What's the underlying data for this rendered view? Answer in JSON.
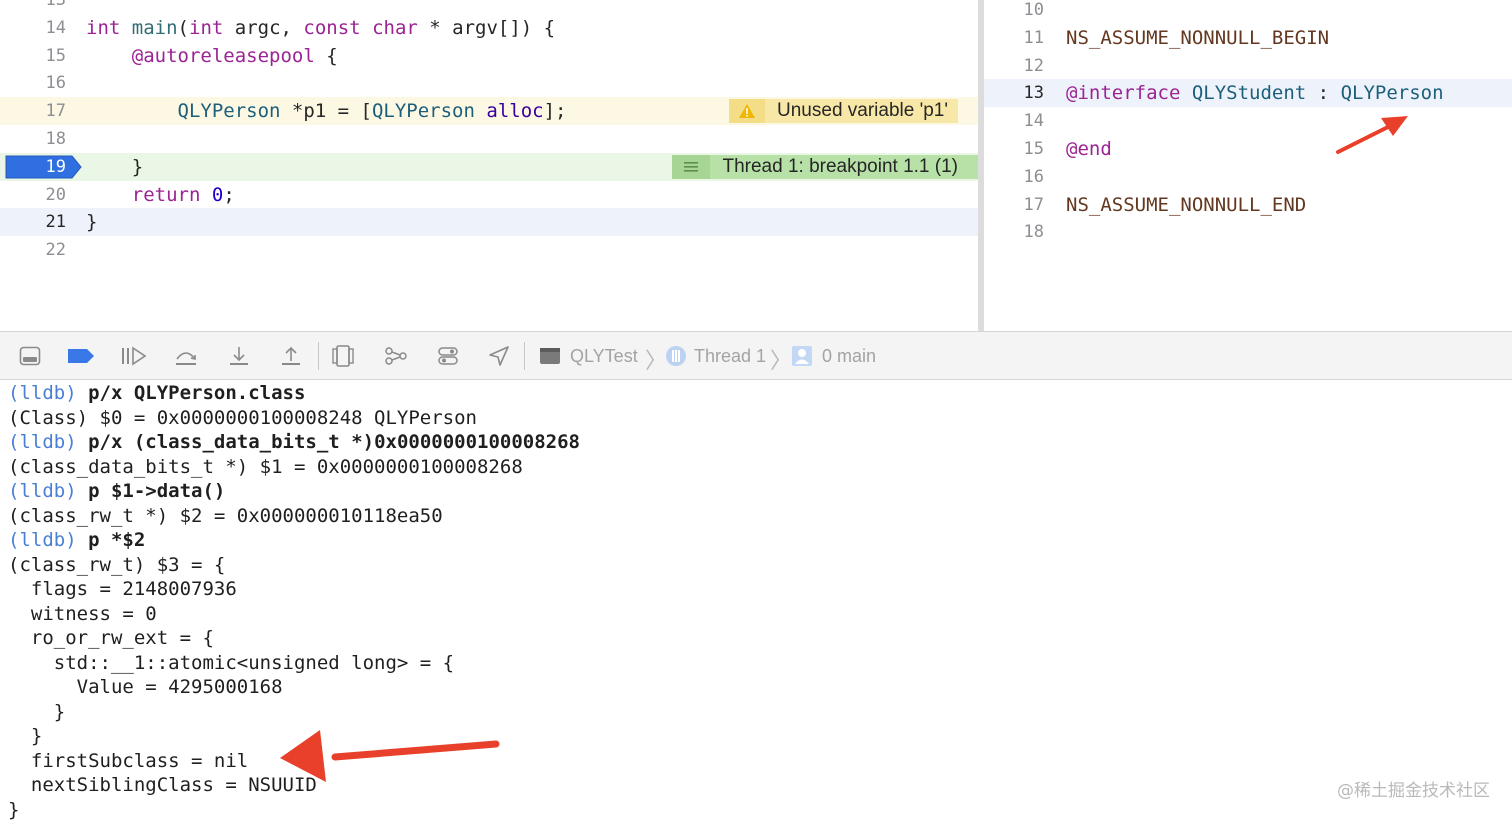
{
  "left_editor": {
    "lines": [
      {
        "num": "13"
      },
      {
        "num": "14",
        "parts": [
          {
            "t": "int",
            "c": "kw"
          },
          {
            "t": " ",
            "c": "pl"
          },
          {
            "t": "main",
            "c": "fn"
          },
          {
            "t": "(",
            "c": "pl"
          },
          {
            "t": "int",
            "c": "kw"
          },
          {
            "t": " argc, ",
            "c": "pl"
          },
          {
            "t": "const",
            "c": "kw"
          },
          {
            "t": " ",
            "c": "pl"
          },
          {
            "t": "char",
            "c": "kw"
          },
          {
            "t": " * argv[]) {",
            "c": "pl"
          }
        ]
      },
      {
        "num": "15",
        "parts": [
          {
            "t": "    ",
            "c": "pl"
          },
          {
            "t": "@autoreleasepool",
            "c": "kw"
          },
          {
            "t": " {",
            "c": "pl"
          }
        ]
      },
      {
        "num": "16",
        "parts": []
      },
      {
        "num": "17",
        "parts": [
          {
            "t": "        ",
            "c": "pl"
          },
          {
            "t": "QLYPerson",
            "c": "ty"
          },
          {
            "t": " *p1 = [",
            "c": "pl"
          },
          {
            "t": "QLYPerson",
            "c": "ty"
          },
          {
            "t": " ",
            "c": "pl"
          },
          {
            "t": "alloc",
            "c": "cls"
          },
          {
            "t": "];",
            "c": "pl"
          }
        ]
      },
      {
        "num": "18",
        "parts": []
      },
      {
        "num": "19",
        "parts": [
          {
            "t": "    }",
            "c": "pl"
          }
        ]
      },
      {
        "num": "20",
        "parts": [
          {
            "t": "    ",
            "c": "pl"
          },
          {
            "t": "return",
            "c": "kw"
          },
          {
            "t": " ",
            "c": "pl"
          },
          {
            "t": "0",
            "c": "num"
          },
          {
            "t": ";",
            "c": "pl"
          }
        ]
      },
      {
        "num": "21",
        "parts": [
          {
            "t": "}",
            "c": "pl"
          }
        ]
      },
      {
        "num": "22",
        "parts": []
      }
    ],
    "warning": "Unused variable 'p1'",
    "breakpoint_label": "Thread 1: breakpoint 1.1 (1)"
  },
  "right_editor": {
    "lines": [
      {
        "num": "10",
        "parts": []
      },
      {
        "num": "11",
        "parts": [
          {
            "t": "NS_ASSUME_NONNULL_BEGIN",
            "c": "mac"
          }
        ]
      },
      {
        "num": "12",
        "parts": []
      },
      {
        "num": "13",
        "parts": [
          {
            "t": "@interface",
            "c": "kw"
          },
          {
            "t": " ",
            "c": "pl"
          },
          {
            "t": "QLYStudent",
            "c": "ty"
          },
          {
            "t": " : ",
            "c": "pl"
          },
          {
            "t": "QLYPerson",
            "c": "ty"
          }
        ]
      },
      {
        "num": "14",
        "parts": []
      },
      {
        "num": "15",
        "parts": [
          {
            "t": "@end",
            "c": "kw"
          }
        ]
      },
      {
        "num": "16",
        "parts": []
      },
      {
        "num": "17",
        "parts": [
          {
            "t": "NS_ASSUME_NONNULL_END",
            "c": "mac"
          }
        ]
      },
      {
        "num": "18",
        "parts": []
      }
    ]
  },
  "debug_bar": {
    "target": "QLYTest",
    "thread": "Thread 1",
    "frame": "0 main"
  },
  "console": {
    "lines": [
      {
        "prompt": "(lldb)",
        "cmd": "p/x QLYPerson.class"
      },
      {
        "text": "(Class) $0 = 0x0000000100008248 QLYPerson"
      },
      {
        "prompt": "(lldb)",
        "cmd": "p/x (class_data_bits_t *)0x0000000100008268"
      },
      {
        "text": "(class_data_bits_t *) $1 = 0x0000000100008268"
      },
      {
        "prompt": "(lldb)",
        "cmd": "p $1->data()"
      },
      {
        "text": "(class_rw_t *) $2 = 0x000000010118ea50"
      },
      {
        "prompt": "(lldb)",
        "cmd": "p *$2"
      },
      {
        "text": "(class_rw_t) $3 = {"
      },
      {
        "text": "  flags = 2148007936"
      },
      {
        "text": "  witness = 0"
      },
      {
        "text": "  ro_or_rw_ext = {"
      },
      {
        "text": "    std::__1::atomic<unsigned long> = {"
      },
      {
        "text": "      Value = 4295000168"
      },
      {
        "text": "    }"
      },
      {
        "text": "  }"
      },
      {
        "text": "  firstSubclass = nil"
      },
      {
        "text": "  nextSiblingClass = NSUUID"
      },
      {
        "text": "}"
      }
    ]
  },
  "watermark": "@稀土掘金技术社区",
  "colors": {
    "arrow": "#e8402a",
    "prompt": "#4a7fd6",
    "breakpoint": "#2f6fe0"
  }
}
